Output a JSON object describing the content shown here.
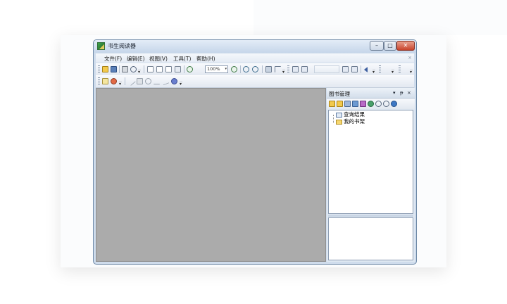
{
  "window": {
    "title": "书生阅读器",
    "controls": {
      "minimize": "–",
      "maximize": "□",
      "close": "✕"
    }
  },
  "menubar": {
    "items": [
      {
        "label": "文件(F)"
      },
      {
        "label": "编辑(E)"
      },
      {
        "label": "视图(V)"
      },
      {
        "label": "工具(T)"
      },
      {
        "label": "帮助(H)"
      }
    ],
    "close_glyph": "×"
  },
  "toolbar": {
    "zoom": {
      "value": "100%",
      "arrow": "▾"
    },
    "icons": [
      "open-icon",
      "save-icon",
      "print-icon",
      "find-icon",
      "single-page-icon",
      "continuous-page-icon",
      "facing-page-icon",
      "fit-page-icon",
      "zoom-out-icon",
      "zoom-in-icon",
      "magnify-in-icon",
      "magnify-out-icon",
      "first-page-icon",
      "previous-page-icon",
      "next-page-icon",
      "last-page-icon"
    ]
  },
  "annotation_toolbar": {
    "icons": [
      "comment-icon",
      "highlight-icon",
      "pen-icon",
      "eraser-icon",
      "line-icon",
      "arrow-icon",
      "stamp-icon"
    ]
  },
  "panel": {
    "title": "图书管理",
    "controls": {
      "menu": "▾",
      "pin": "ᵽ",
      "close": "×"
    },
    "tree": [
      {
        "label": "查询结果",
        "icon": "search-result-icon"
      },
      {
        "label": "我的书架",
        "icon": "folder-icon"
      }
    ]
  },
  "colors": {
    "document_area": "#ababab",
    "window_frame": "#cfdcec",
    "close_button": "#c8432b"
  }
}
